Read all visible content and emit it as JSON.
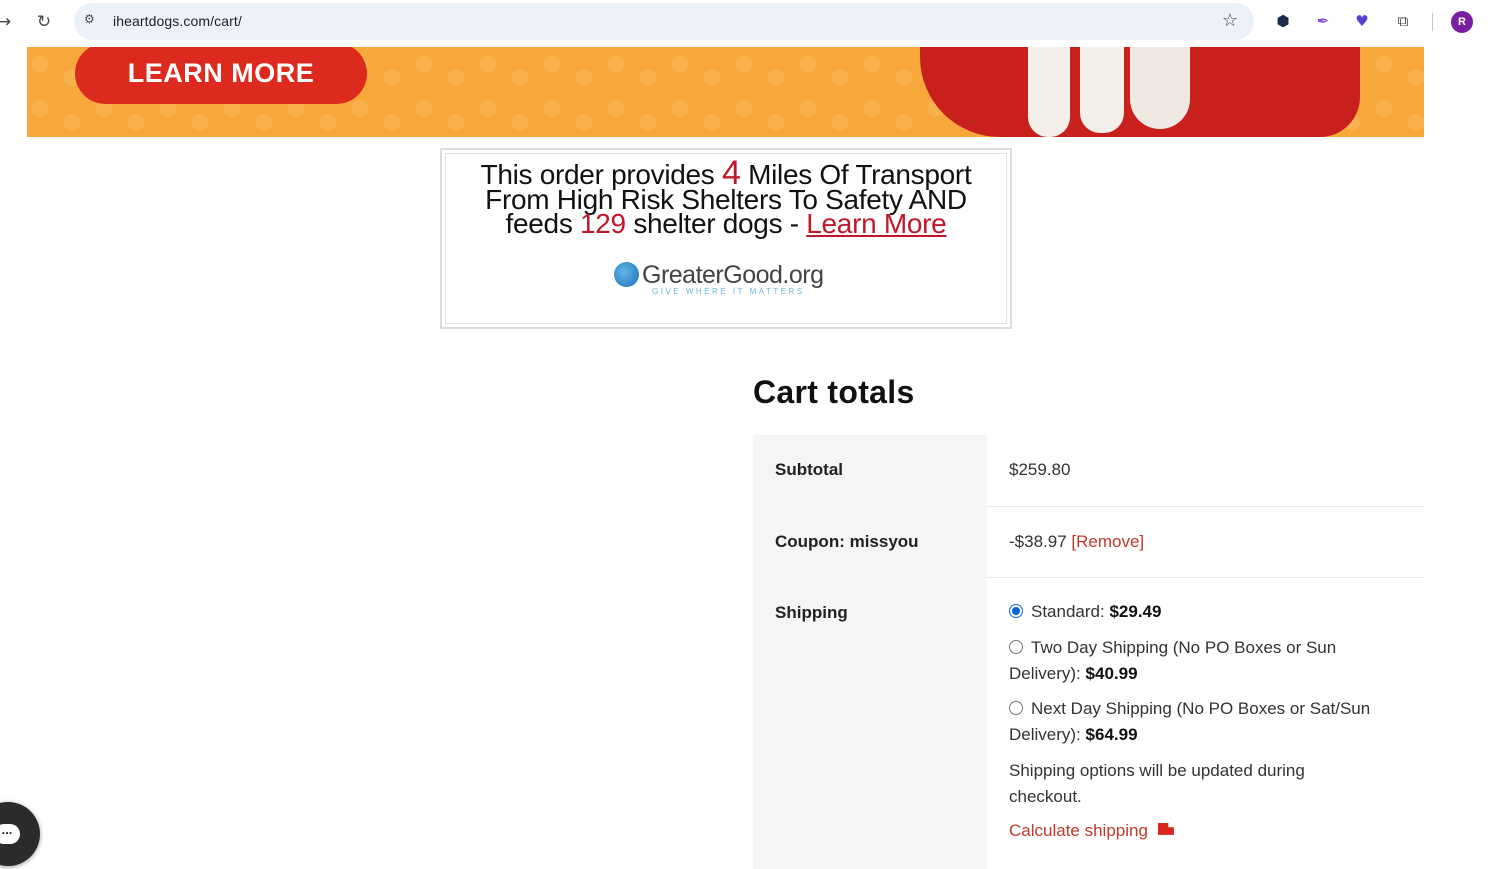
{
  "browser": {
    "url": "iheartdogs.com/cart/",
    "profile_initial": "R",
    "icons": [
      "back-arrow-icon",
      "reload-icon",
      "site-settings-icon",
      "bookmark-star-icon",
      "extension-hex-icon",
      "extension-pen-icon",
      "extension-puzzle-color-icon",
      "extensions-puzzle-icon"
    ]
  },
  "banner": {
    "button_label": "LEARN MORE",
    "colors": {
      "background": "#f8a83a",
      "button": "#dd2a1f"
    }
  },
  "impact": {
    "line1_pre": "This order provides",
    "miles": "4",
    "line1_post": "Miles Of Transport",
    "line2": "From High Risk Shelters To Safety AND",
    "line3_pre": "feeds",
    "dogs": "129",
    "line3_post": "shelter dogs -",
    "link": "Learn More",
    "logo_name": "GreaterGood.org",
    "logo_tagline": "GIVE WHERE IT MATTERS",
    "accent_color": "#c0182a"
  },
  "cart": {
    "title": "Cart totals",
    "subtotal_label": "Subtotal",
    "subtotal_value": "$259.80",
    "coupon_label": "Coupon: missyou",
    "coupon_value": "-$38.97",
    "coupon_remove": "[Remove]",
    "shipping_label": "Shipping",
    "shipping_options": [
      {
        "label": "Standard:",
        "price": "$29.49",
        "selected": true
      },
      {
        "label": "Two Day Shipping (No PO Boxes or Sun Delivery):",
        "price": "$40.99",
        "selected": false
      },
      {
        "label": "Next Day Shipping (No PO Boxes or Sat/Sun Delivery):",
        "price": "$64.99",
        "selected": false
      }
    ],
    "shipping_note": "Shipping options will be updated during checkout.",
    "calculate_shipping": "Calculate shipping"
  },
  "chat": {
    "icon": "chat-bubble-icon",
    "glyph": "..."
  }
}
